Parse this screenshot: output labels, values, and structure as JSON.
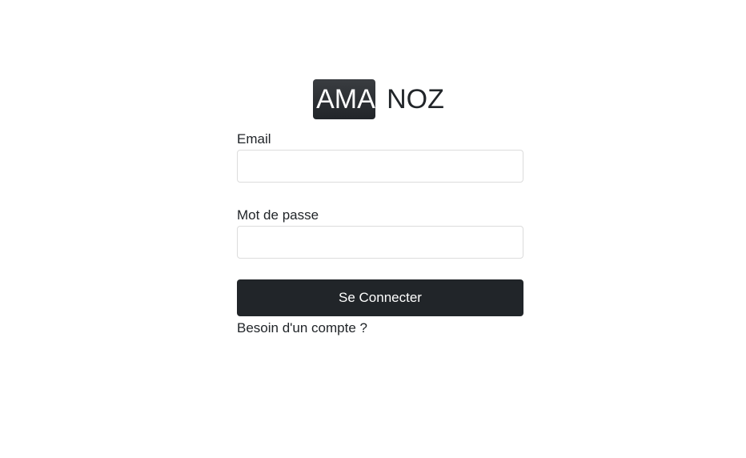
{
  "logo": {
    "badge_text": "AMA",
    "text": "NOZ"
  },
  "form": {
    "email_label": "Email",
    "email_value": "",
    "password_label": "Mot de passe",
    "password_value": "",
    "submit_label": "Se Connecter",
    "signup_link": "Besoin d'un compte ?"
  }
}
